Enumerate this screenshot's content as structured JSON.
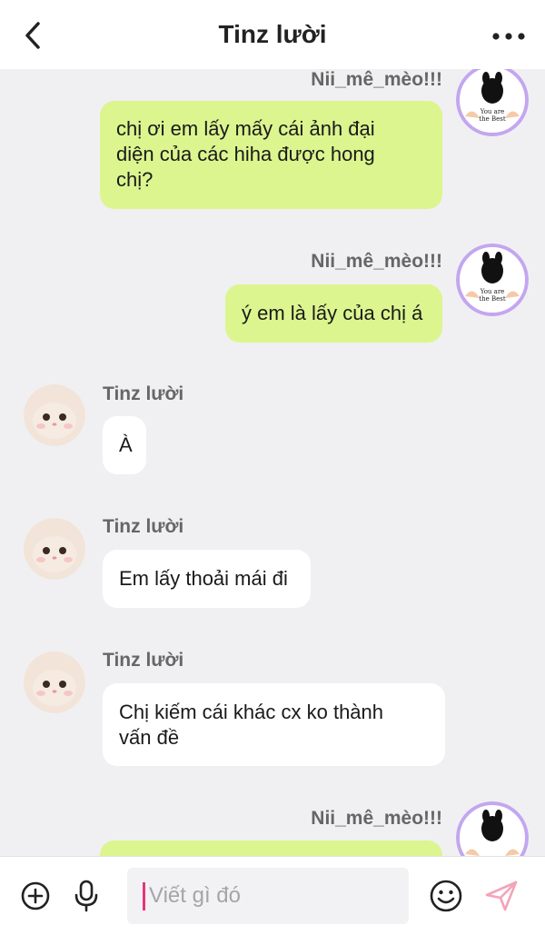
{
  "header": {
    "title": "Tinz lười"
  },
  "messages": [
    {
      "sender": "Nii_mê_mèo!!!",
      "lines": [
        "chị ơi em lấy mấy cái ảnh đại",
        "diện của các hiha được hong",
        "chị?"
      ]
    },
    {
      "sender": "Nii_mê_mèo!!!",
      "lines": [
        "ý em là lấy của chị á"
      ]
    },
    {
      "sender": "Tinz lười",
      "lines": [
        "À"
      ]
    },
    {
      "sender": "Tinz lười",
      "lines": [
        "Em lấy thoải mái đi"
      ]
    },
    {
      "sender": "Tinz lười",
      "lines": [
        "Chị kiếm cái khác cx ko thành",
        "vấn đề"
      ]
    },
    {
      "sender": "Nii_mê_mèo!!!",
      "lines": []
    }
  ],
  "avatar_me": {
    "text_lines": [
      "You are",
      "the Best"
    ]
  },
  "composer": {
    "placeholder": "Viết gì đó"
  },
  "colors": {
    "my_bubble": "#dcf58f",
    "their_bubble": "#ffffff",
    "background": "#f0f0f2",
    "caret": "#e8347a",
    "send": "#f4a3b8"
  },
  "icons": [
    "back-arrow-icon",
    "more-dots-icon",
    "plus-circle-icon",
    "microphone-icon",
    "smiley-icon",
    "send-icon"
  ]
}
